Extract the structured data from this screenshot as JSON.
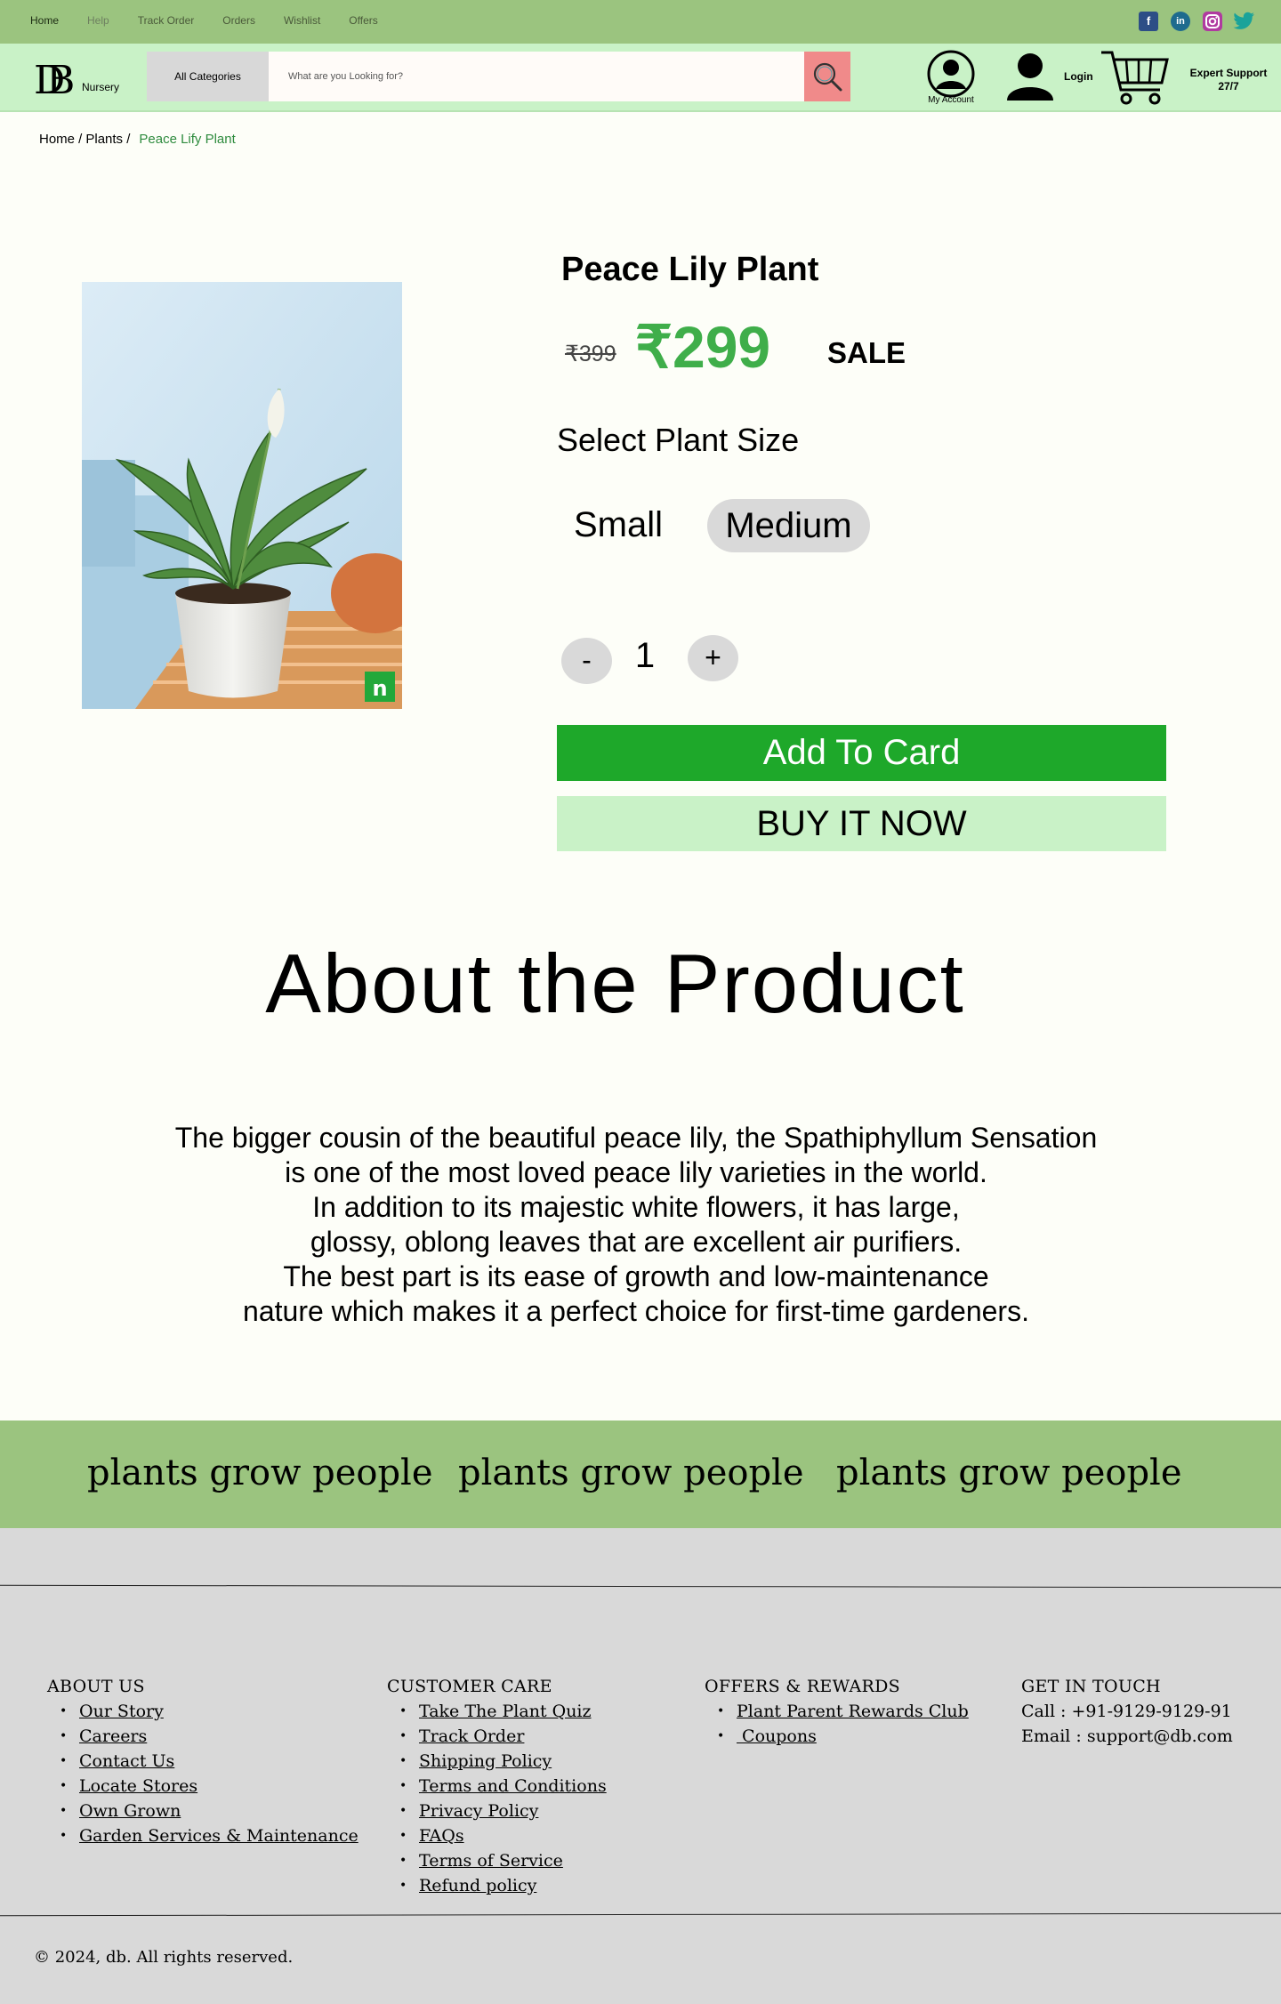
{
  "topnav": {
    "items": [
      "Home",
      "Help",
      "Track Order",
      "Orders",
      "Wishlist",
      "Offers"
    ]
  },
  "social": {
    "icons": [
      "facebook-icon",
      "linkedin-icon",
      "instagram-icon",
      "twitter-icon"
    ]
  },
  "header": {
    "logo_text": "DB",
    "logo_sub": "Nursery",
    "category_button": "All Categories",
    "search_placeholder": "What are you Looking for?",
    "account_label": "My Account",
    "login_label": "Login",
    "support_line1": "Expert Support",
    "support_line2": "27/7"
  },
  "breadcrumb": {
    "items": [
      "Home /",
      "Plants /"
    ],
    "current": "Peace Lify Plant"
  },
  "product": {
    "title": "Peace Lily Plant",
    "old_price": "₹399",
    "price": "₹299",
    "sale": "SALE",
    "size_label": "Select Plant Size",
    "sizes": [
      "Small",
      "Medium"
    ],
    "selected_size": "Medium",
    "quantity": "1",
    "minus": "-",
    "plus": "+",
    "add_button": "Add To Card",
    "buy_button": "BUY IT NOW"
  },
  "about": {
    "title": "About the Product",
    "lines": [
      "The bigger cousin of the beautiful peace lily, the Spathiphyllum Sensation",
      "is one of the most loved peace lily varieties in the world.",
      "In addition to its majestic white flowers, it has large,",
      "glossy, oblong leaves that are excellent air purifiers.",
      "The best part is its ease of growth and low-maintenance",
      "nature which makes it a perfect choice for first-time gardeners."
    ]
  },
  "banner": {
    "texts": [
      "plants grow people",
      "plants grow people",
      "plants grow people"
    ]
  },
  "footer": {
    "about": {
      "heading": "ABOUT US",
      "links": [
        "Our Story",
        "Careers",
        "Contact Us",
        "Locate Stores",
        "Own Grown",
        "Garden Services & Maintenance"
      ]
    },
    "care": {
      "heading": "CUSTOMER CARE",
      "links": [
        "Take The Plant Quiz",
        "Track Order",
        "Shipping Policy",
        "Terms and Conditions",
        "Privacy Policy",
        "FAQs",
        "Terms of Service",
        "Refund policy"
      ]
    },
    "offers": {
      "heading": "OFFERS & REWARDS",
      "links": [
        "Plant Parent Rewards Club",
        " Coupons"
      ]
    },
    "contact": {
      "heading": "GET IN TOUCH",
      "call": "Call : +91-9129-9129-91",
      "email": "Email : support@db.com"
    },
    "copyright": "© 2024, db. All rights reserved."
  },
  "colors": {
    "topbar": "#9bc47f",
    "header": "#c9f2c7",
    "accent_green": "#1ea82a",
    "price_green": "#3fae4a",
    "search_button": "#f08a8a",
    "footer": "#d9d9d9"
  }
}
